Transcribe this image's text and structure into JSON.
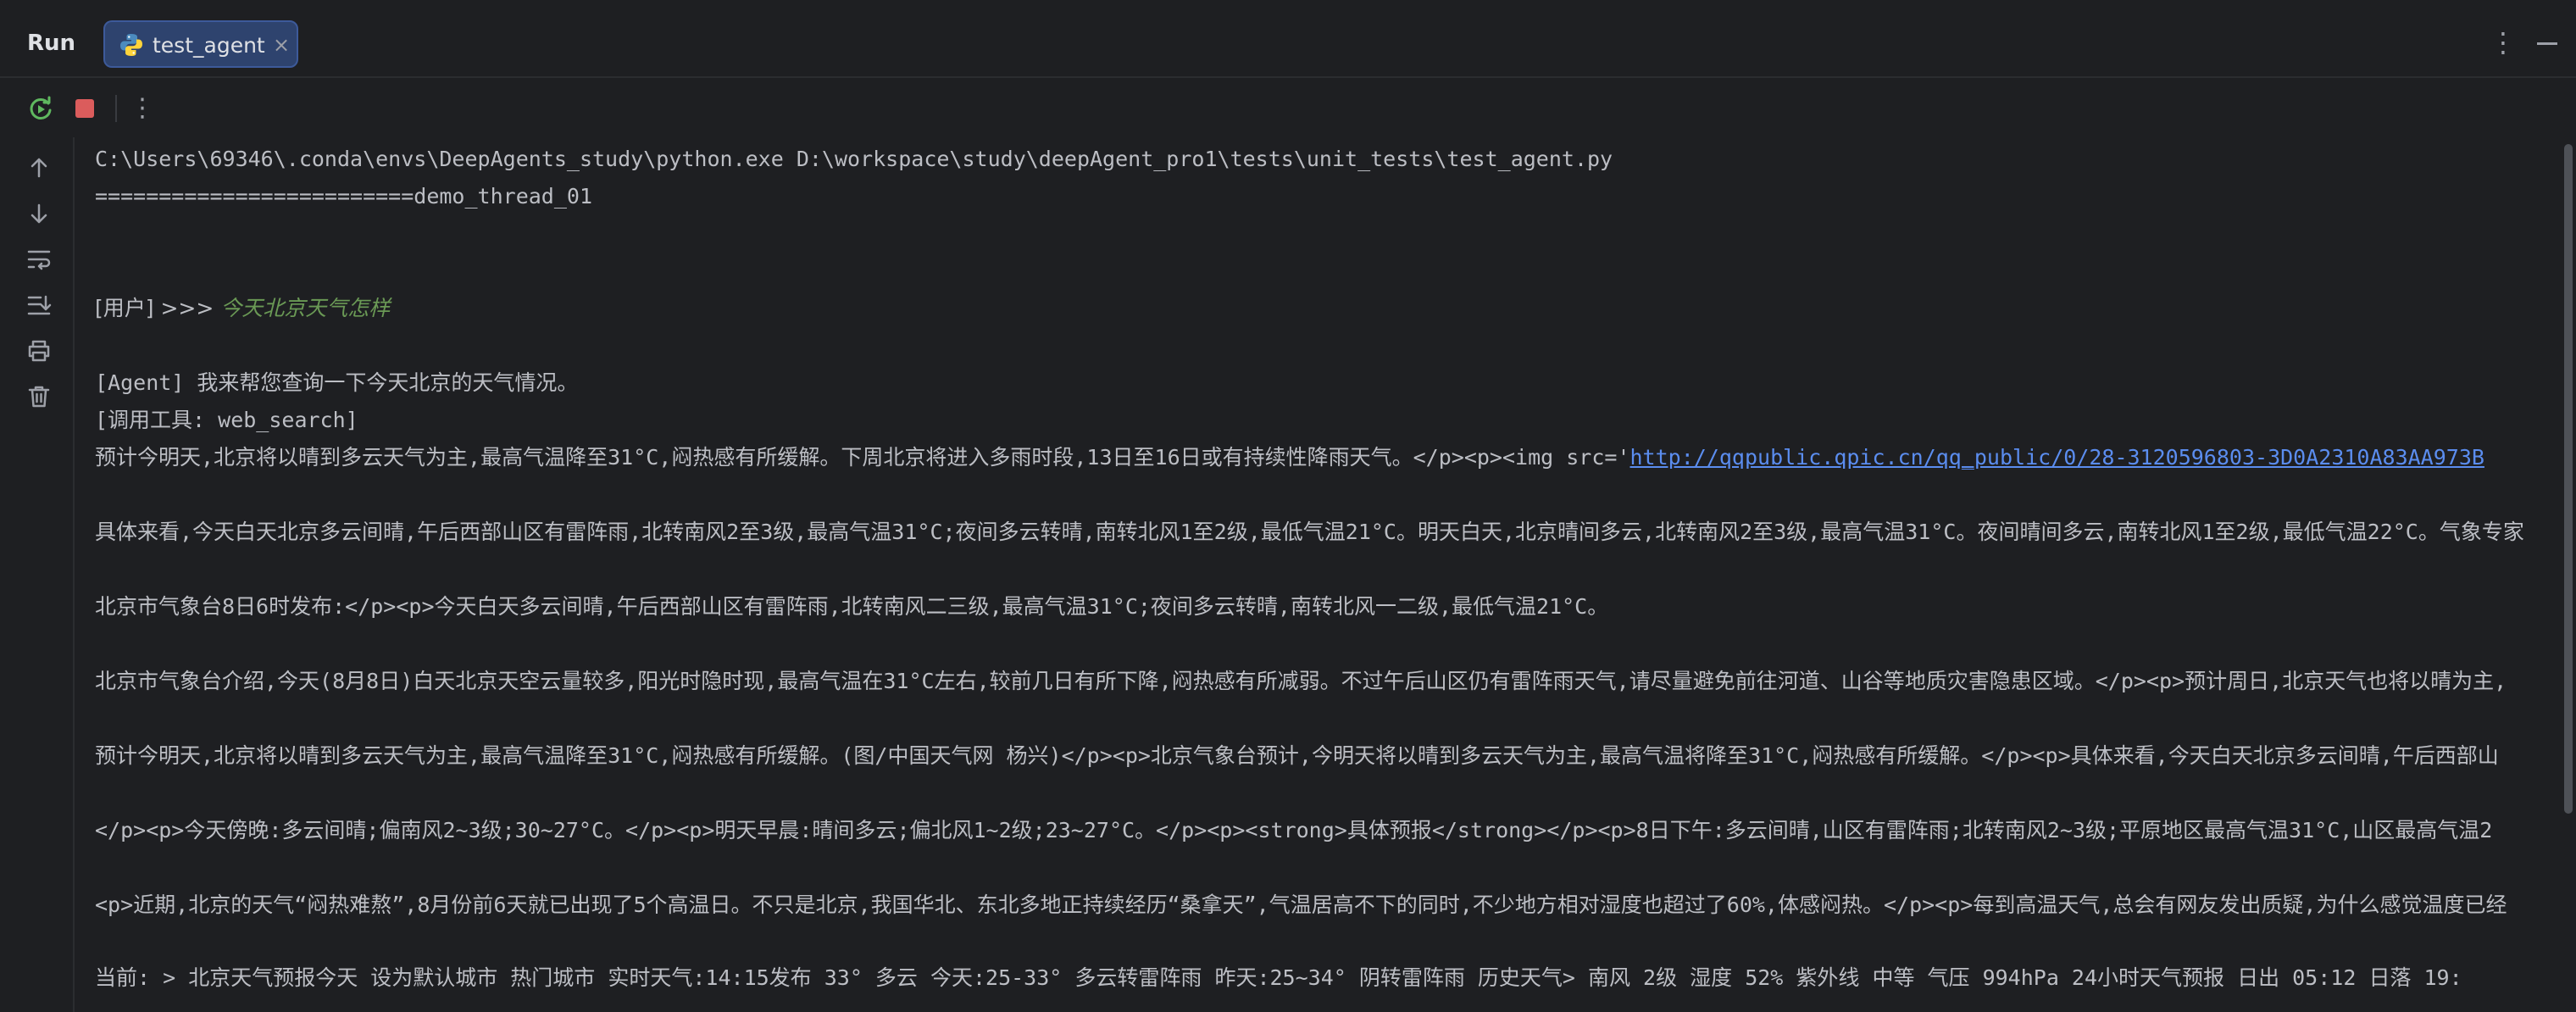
{
  "header": {
    "run_label": "Run",
    "tab_label": "test_agent",
    "tab_close": "×",
    "more": "⋮"
  },
  "toolbar": {
    "more": "⋮"
  },
  "colors": {
    "background": "#1e1f22",
    "tab_active": "#2e436e",
    "stop_red": "#db5c5c",
    "rerun_green": "#5fb85f",
    "user_query_green": "#6a9955",
    "link_blue": "#5b8def"
  },
  "icons": {
    "toolbar": [
      "rerun-icon",
      "stop-icon",
      "more-vertical-icon"
    ],
    "gutter": [
      "arrow-up-icon",
      "arrow-down-icon",
      "soft-wrap-icon",
      "scroll-to-end-icon",
      "print-icon",
      "trash-icon"
    ]
  },
  "console": {
    "lines": [
      "C:\\Users\\69346\\.conda\\envs\\DeepAgents_study\\python.exe D:\\workspace\\study\\deepAgent_pro1\\tests\\unit_tests\\test_agent.py",
      "=========================demo_thread_01"
    ],
    "user_prefix": "[用户] >>> ",
    "user_query": "今天北京天气怎样",
    "agent_line": "[Agent] 我来帮您查询一下今天北京的天气情况。",
    "tool_line": "[调用工具: web_search]",
    "result_prefix": "预计今明天,北京将以晴到多云天气为主,最高气温降至31°C,闷热感有所缓解。下周北京将进入多雨时段,13日至16日或有持续性降雨天气。</p><p><img src='",
    "result_link": "http://qqpublic.qpic.cn/qq_public/0/28-3120596803-3D0A2310A83AA973B",
    "paragraphs": [
      "具体来看,今天白天北京多云间晴,午后西部山区有雷阵雨,北转南风2至3级,最高气温31°C;夜间多云转晴,南转北风1至2级,最低气温21°C。明天白天,北京晴间多云,北转南风2至3级,最高气温31°C。夜间晴间多云,南转北风1至2级,最低气温22°C。气象专家",
      "北京市气象台8日6时发布:</p><p>今天白天多云间晴,午后西部山区有雷阵雨,北转南风二三级,最高气温31°C;夜间多云转晴,南转北风一二级,最低气温21°C。",
      "北京市气象台介绍,今天(8月8日)白天北京天空云量较多,阳光时隐时现,最高气温在31°C左右,较前几日有所下降,闷热感有所减弱。不过午后山区仍有雷阵雨天气,请尽量避免前往河道、山谷等地质灾害隐患区域。</p><p>预计周日,北京天气也将以晴为主,",
      "预计今明天,北京将以晴到多云天气为主,最高气温降至31°C,闷热感有所缓解。(图/中国天气网 杨兴)</p><p>北京气象台预计,今明天将以晴到多云天气为主,最高气温将降至31°C,闷热感有所缓解。</p><p>具体来看,今天白天北京多云间晴,午后西部山",
      "</p><p>今天傍晚:多云间晴;偏南风2~3级;30~27°C。</p><p>明天早晨:晴间多云;偏北风1~2级;23~27°C。</p><p><strong>具体预报</strong></p><p>8日下午:多云间晴,山区有雷阵雨;北转南风2~3级;平原地区最高气温31°C,山区最高气温2",
      "<p>近期,北京的天气“闷热难熬”,8月份前6天就已出现了5个高温日。不只是北京,我国华北、东北多地正持续经历“桑拿天”,气温居高不下的同时,不少地方相对湿度也超过了60%,体感闷热。</p><p>每到高温天气,总会有网友发出质疑,为什么感觉温度已经",
      "当前: > 北京天气预报今天 设为默认城市 热门城市 实时天气:14:15发布 33° 多云 今天:25-33° 多云转雷阵雨 昨天:25~34° 阴转雷阵雨 历史天气> 南风 2级 湿度 52% 紫外线 中等 气压 994hPa 24小时天气预报 日出 05:12 日落 19:"
    ]
  }
}
